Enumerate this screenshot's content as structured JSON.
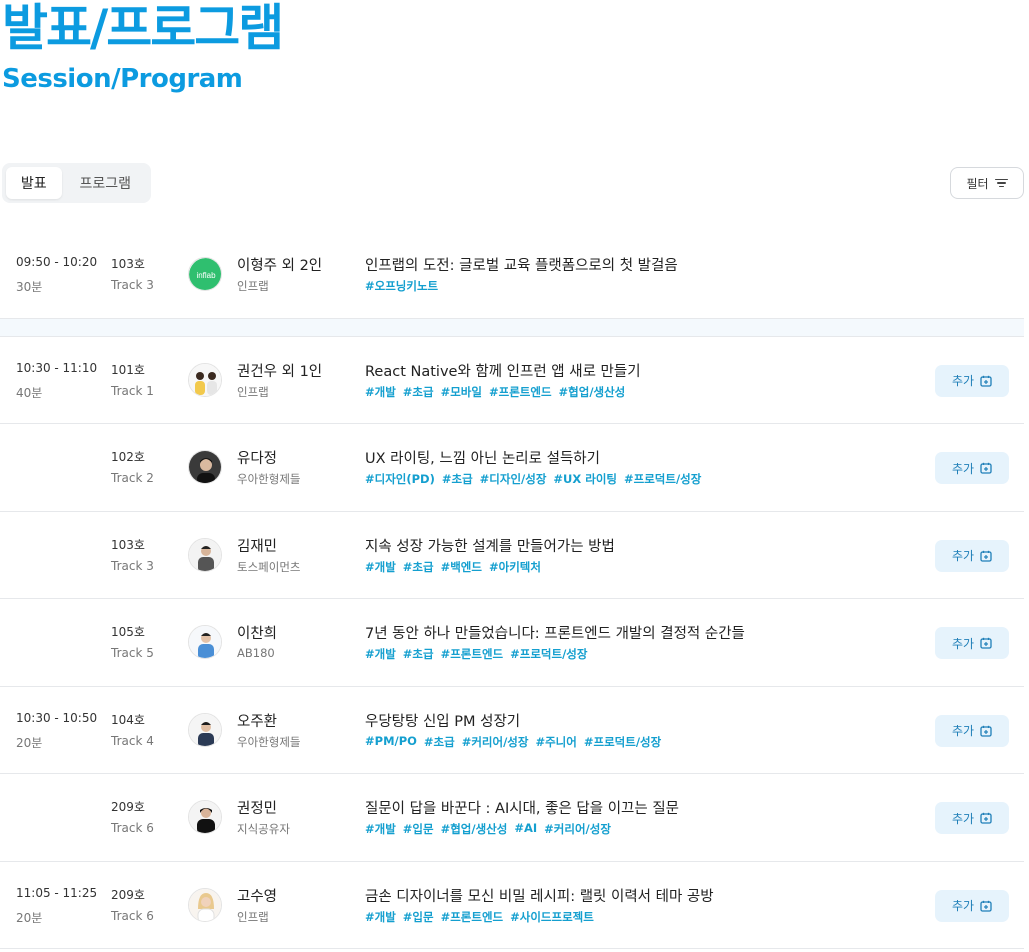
{
  "header": {
    "title": "발표/프로그램",
    "subtitle": "Session/Program"
  },
  "tabs": [
    {
      "label": "발표",
      "active": true
    },
    {
      "label": "프로그램",
      "active": false
    }
  ],
  "filter": {
    "label": "필터"
  },
  "add_label": "추가",
  "colors": {
    "accent": "#0c9be0",
    "tag": "#149fcf",
    "add_bg": "#e6f3fc"
  },
  "sessions": [
    {
      "time": "09:50 - 10:20",
      "duration": "30분",
      "room": "103호",
      "track": "Track 3",
      "speaker": "이형주 외 2인",
      "company": "인프랩",
      "title": "인프랩의 도전: 글로벌 교육 플랫폼으로의 첫 발걸음",
      "tags": [
        "#오프닝키노트"
      ],
      "avatar": "inflab-logo",
      "logo_text": "inflab",
      "add": false
    },
    {
      "time": "10:30 - 11:10",
      "duration": "40분",
      "room": "101호",
      "track": "Track 1",
      "speaker": "권건우 외 1인",
      "company": "인프랩",
      "title": "React Native와 함께 인프런 앱 새로 만들기",
      "tags": [
        "#개발",
        "#초급",
        "#모바일",
        "#프론트엔드",
        "#협업/생산성"
      ],
      "avatar": "person-pair",
      "add": true
    },
    {
      "time": "",
      "duration": "",
      "room": "102호",
      "track": "Track 2",
      "speaker": "유다정",
      "company": "우아한형제들",
      "title": "UX 라이팅, 느낌 아닌 논리로 설득하기",
      "tags": [
        "#디자인(PD)",
        "#초급",
        "#디자인/성장",
        "#UX 라이팅",
        "#프로덕트/성장"
      ],
      "avatar": "person-dark",
      "add": true
    },
    {
      "time": "",
      "duration": "",
      "room": "103호",
      "track": "Track 3",
      "speaker": "김재민",
      "company": "토스페이먼츠",
      "title": "지속 성장 가능한 설계를 만들어가는 방법",
      "tags": [
        "#개발",
        "#초급",
        "#백엔드",
        "#아키텍처"
      ],
      "avatar": "person-gray",
      "add": true
    },
    {
      "time": "",
      "duration": "",
      "room": "105호",
      "track": "Track 5",
      "speaker": "이찬희",
      "company": "AB180",
      "title": "7년 동안 하나 만들었습니다: 프론트엔드 개발의 결정적 순간들",
      "tags": [
        "#개발",
        "#초급",
        "#프론트엔드",
        "#프로덕트/성장"
      ],
      "avatar": "person-blue",
      "add": true
    },
    {
      "time": "10:30 - 10:50",
      "duration": "20분",
      "room": "104호",
      "track": "Track 4",
      "speaker": "오주환",
      "company": "우아한형제들",
      "title": "우당탕탕 신입 PM 성장기",
      "tags": [
        "#PM/PO",
        "#초급",
        "#커리어/성장",
        "#주니어",
        "#프로덕트/성장"
      ],
      "avatar": "person-navy",
      "add": true
    },
    {
      "time": "",
      "duration": "",
      "room": "209호",
      "track": "Track 6",
      "speaker": "권정민",
      "company": "지식공유자",
      "title": "질문이 답을 바꾼다 : AI시대, 좋은 답을 이끄는 질문",
      "tags": [
        "#개발",
        "#입문",
        "#협업/생산성",
        "#AI",
        "#커리어/성장"
      ],
      "avatar": "person-black",
      "add": true
    },
    {
      "time": "11:05 - 11:25",
      "duration": "20분",
      "room": "209호",
      "track": "Track 6",
      "speaker": "고수영",
      "company": "인프랩",
      "title": "금손 디자이너를 모신 비밀 레시피: 랠릿 이력서 테마 공방",
      "tags": [
        "#개발",
        "#입문",
        "#프론트엔드",
        "#사이드프로젝트"
      ],
      "avatar": "person-blonde",
      "add": true
    }
  ]
}
